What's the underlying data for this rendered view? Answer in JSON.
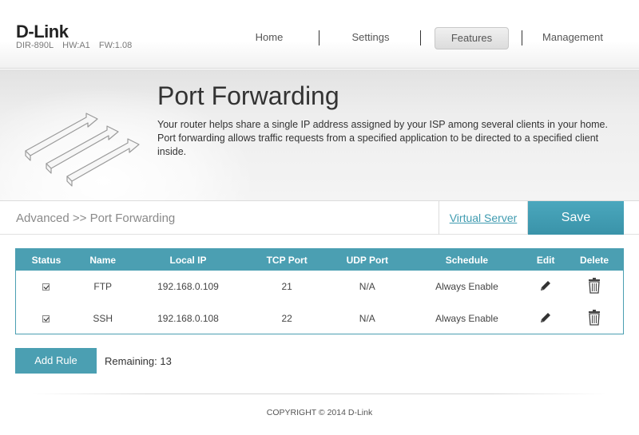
{
  "header": {
    "logo": "D-Link",
    "model": "DIR-890L",
    "hw": "HW:A1",
    "fw": "FW:1.08",
    "nav": [
      "Home",
      "Settings",
      "Features",
      "Management"
    ],
    "active_nav": "Features"
  },
  "banner": {
    "title": "Port Forwarding",
    "description": "Your router helps share a single IP address assigned by your ISP among several clients in your home. Port forwarding allows traffic requests from a specified application to be directed to a specified client inside."
  },
  "crumb": {
    "path": "Advanced >> Port Forwarding",
    "virtual_server": "Virtual Server",
    "save": "Save"
  },
  "table": {
    "headers": [
      "Status",
      "Name",
      "Local IP",
      "TCP Port",
      "UDP Port",
      "Schedule",
      "Edit",
      "Delete"
    ],
    "rows": [
      {
        "status": true,
        "name": "FTP",
        "local_ip": "192.168.0.109",
        "tcp": "21",
        "udp": "N/A",
        "schedule": "Always Enable"
      },
      {
        "status": true,
        "name": "SSH",
        "local_ip": "192.168.0.108",
        "tcp": "22",
        "udp": "N/A",
        "schedule": "Always Enable"
      }
    ]
  },
  "actions": {
    "add_rule": "Add Rule",
    "remaining": "Remaining: 13"
  },
  "footer": {
    "copyright": "COPYRIGHT © 2014 D-Link"
  },
  "colors": {
    "accent": "#4b9fb2",
    "link": "#3f9bb0"
  },
  "icons": {
    "edit": "pencil-icon",
    "delete": "trash-icon",
    "banner": "port-arrows-icon"
  }
}
